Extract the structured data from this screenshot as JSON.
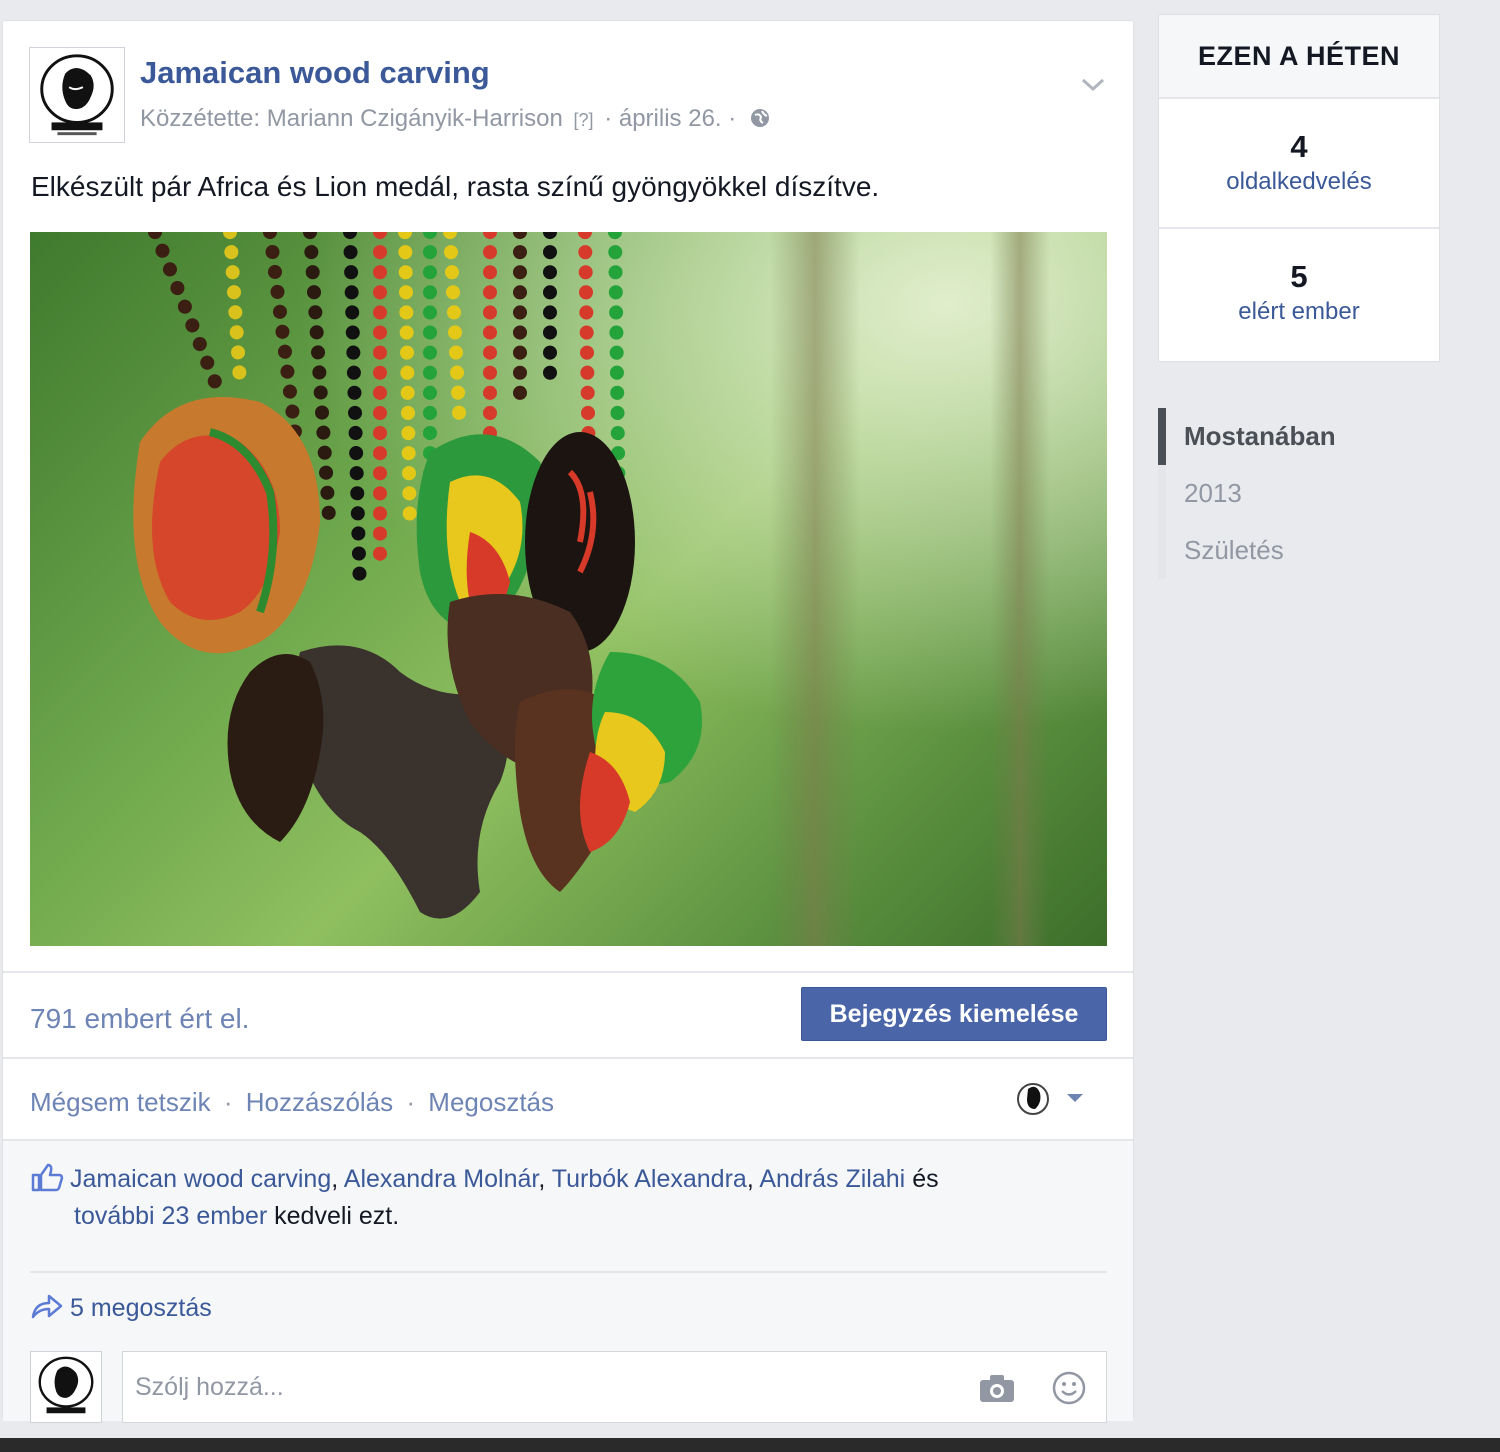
{
  "post": {
    "page_name": "Jamaican wood carving",
    "meta_prefix": "Közzétette: Mariann Czigányik-Harrison",
    "meta_q": "[?]",
    "meta_date": "· április 26. ·",
    "text": "Elkészült pár Africa és Lion medál, rasta színű gyöngyökkel díszítve.",
    "reach": "791 embert ért el.",
    "boost_label": "Bejegyzés kiemelése",
    "actions": {
      "unlike": "Mégsem tetszik",
      "comment": "Hozzászólás",
      "share": "Megosztás",
      "sep": "·"
    },
    "likes": {
      "names": [
        "Jamaican wood carving",
        "Alexandra Molnár",
        "Turbók Alexandra",
        "András Zilahi"
      ],
      "sep": ", ",
      "and_word": "és",
      "others": "további 23 ember",
      "suffix": "kedveli ezt."
    },
    "shares": "5 megosztás",
    "comment_placeholder": "Szólj hozzá..."
  },
  "sidebar": {
    "title": "EZEN A HÉTEN",
    "stats": [
      {
        "value": "4",
        "label": "oldalkedvelés"
      },
      {
        "value": "5",
        "label": "elért ember"
      }
    ]
  },
  "timeline": {
    "items": [
      {
        "label": "Mostanában",
        "active": true
      },
      {
        "label": "2013",
        "active": false
      },
      {
        "label": "Születés",
        "active": false
      }
    ]
  },
  "icons": {
    "avatar": "hillman-logo-icon",
    "globe": "globe-icon",
    "chevron": "chevron-down-icon",
    "like": "thumbs-up-icon",
    "share": "share-arrow-icon",
    "camera": "camera-icon",
    "smile": "smiley-icon"
  },
  "colors": {
    "link": "#3b5998",
    "boost": "#4a66a8",
    "background": "#e9eaed"
  }
}
